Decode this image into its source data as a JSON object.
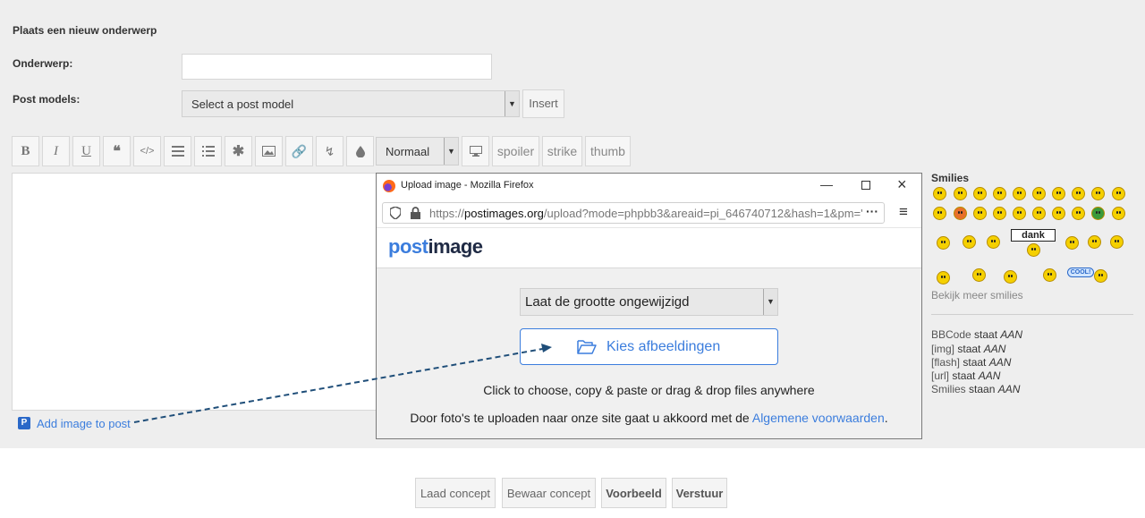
{
  "form": {
    "heading": "Plaats een nieuw onderwerp",
    "subject_label": "Onderwerp:",
    "subject_value": "",
    "post_models_label": "Post models:",
    "post_model_selected": "Select a post model",
    "insert_label": "Insert"
  },
  "toolbar": {
    "bold": "B",
    "italic": "I",
    "underline": "U",
    "size_selected": "Normaal",
    "spoiler": "spoiler",
    "strike": "strike",
    "thumb": "thumb"
  },
  "add_image_label": "Add image to post",
  "smilies": {
    "title": "Smilies",
    "dank": "dank",
    "cool": "COOL!",
    "more": "Bekijk meer smilies"
  },
  "status": {
    "bbcode": "BBCode",
    "img": "[img]",
    "flash": "[flash]",
    "url": "[url]",
    "smilies": "Smilies",
    "staat": "staat",
    "staan": "staan",
    "on": "AAN"
  },
  "popup": {
    "window_title": "Upload image - Mozilla Firefox",
    "url_prefix": "https://",
    "url_host": "postimages.org",
    "url_rest": "/upload?mode=phpbb3&areaid=pi_646740712&hash=1&pm='",
    "logo_post": "post",
    "logo_image": "image",
    "resize_selected": "Laat de grootte ongewijzigd",
    "choose_label": "Kies afbeeldingen",
    "instructions": "Click to choose, copy & paste or drag & drop files anywhere",
    "terms_prefix": "Door foto's te uploaden naar onze site gaat u akkoord met de",
    "terms_link": "Algemene voorwaarden",
    "terms_suffix": "."
  },
  "actions": {
    "load_draft": "Laad concept",
    "save_draft": "Bewaar concept",
    "preview": "Voorbeeld",
    "submit": "Verstuur"
  },
  "colors": {
    "accent": "#3b7ddd",
    "logo_dark": "#1f2a44",
    "smiley": "#f5d000",
    "arrow": "#1f4e79"
  }
}
